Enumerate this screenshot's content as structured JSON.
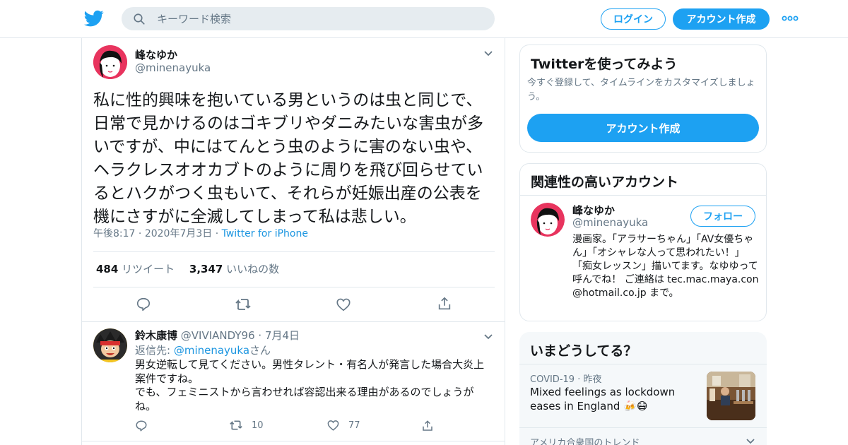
{
  "header": {
    "search_placeholder": "キーワード検索",
    "login_label": "ログイン",
    "signup_label": "アカウント作成"
  },
  "tweet": {
    "author_name": "峰なゆか",
    "author_handle": "@minenayuka",
    "text": "私に性的興味を抱いている男というのは虫と同じで、日常で見かけるのはゴキブリやダニみたいな害虫が多いですが、中にはてんとう虫のように害のない虫や、ヘラクレスオオカブトのように周りを飛び回らせているとハクがつく虫もいて、それらが妊娠出産の公表を機にさすがに全滅してしまって私は悲しい。",
    "time": "午後8:17",
    "date": "2020年7月3日",
    "source": "Twitter for iPhone",
    "retweet_count": "484",
    "retweet_label": "リツイート",
    "like_count": "3,347",
    "like_label": "いいねの数"
  },
  "reply": {
    "author_name": "鈴木康博",
    "author_handle": "@VIVIANDY96",
    "date": "7月4日",
    "replying_to_prefix": "返信先: ",
    "replying_to_handle": "@minenayuka",
    "replying_to_suffix": "さん",
    "text_line1": "男女逆転して見てください。男性タレント・有名人が発言した場合大炎上案件ですね。",
    "text_line2": "でも、フェミニストから言わせれば容認出来る理由があるのでしょうがね。",
    "retweet_count": "10",
    "like_count": "77"
  },
  "signup_card": {
    "title": "Twitterを使ってみよう",
    "description": "今すぐ登録して、タイムラインをカスタマイズしましょう。",
    "button_label": "アカウント作成"
  },
  "related_card": {
    "title": "関連性の高いアカウント",
    "name": "峰なゆか",
    "handle": "@minenayuka",
    "follow_label": "フォロー",
    "bio": "漫画家。「アラサーちゃん」「AV女優ちゃん」「オシャレな人って思われたい！」「痴女レッスン」描いてます。なゆゆって呼んでね！ ご連絡は tec.mac.maya.con@hotmail.co.jp まで。"
  },
  "trends_card": {
    "title": "いまどうしてる？",
    "item_category": "COVID-19",
    "item_time": "昨夜",
    "item_headline": "Mixed feelings as lockdown eases in England 🍻😷",
    "next_label": "アメリカ合衆国のトレンド"
  },
  "colors": {
    "brand": "#1da1f2",
    "link": "#1b95e0",
    "muted": "#657786",
    "border": "#e1e8ed"
  },
  "icons": [
    "twitter-bird-icon",
    "search-icon",
    "more-dots-icon",
    "chevron-down-icon",
    "reply-icon",
    "retweet-icon",
    "like-icon",
    "share-icon"
  ]
}
